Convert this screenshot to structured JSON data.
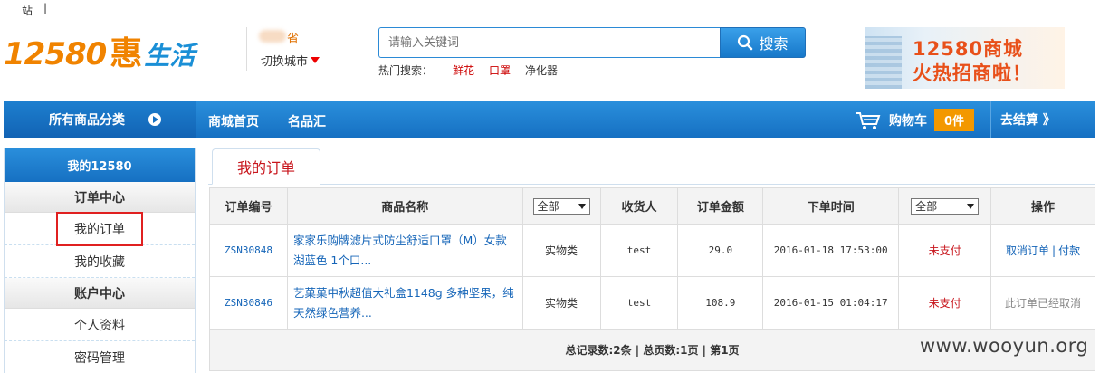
{
  "topbar": {
    "site_char": "站",
    "separator": "|"
  },
  "logo": {
    "number": "12580",
    "hui": "惠",
    "shenghuo": "生活"
  },
  "location": {
    "province_suffix": "省",
    "switch_city": "切换城市"
  },
  "search": {
    "placeholder": "请输入关键词",
    "button_label": "搜索"
  },
  "hot_search": {
    "label": "热门搜索：",
    "items": [
      "鲜花",
      "口罩",
      "净化器"
    ]
  },
  "banner": {
    "line1": "12580商城",
    "line2": "火热招商啦！"
  },
  "nav": {
    "all_categories": "所有商品分类",
    "links": [
      "商城首页",
      "名品汇"
    ],
    "cart_label": "购物车",
    "cart_count": "0件",
    "checkout": "去结算 》"
  },
  "sidebar": {
    "header": "我的12580",
    "sections": [
      {
        "title": "订单中心",
        "items": [
          "我的订单",
          "我的收藏"
        ]
      },
      {
        "title": "账户中心",
        "items": [
          "个人资料",
          "密码管理"
        ]
      }
    ]
  },
  "content": {
    "tab": "我的订单",
    "columns": [
      "订单编号",
      "商品名称",
      "全部",
      "收货人",
      "订单金额",
      "下单时间",
      "全部",
      "操作"
    ],
    "rows": [
      {
        "order_id": "ZSN30848",
        "product": "家家乐购牌滤片式防尘舒适口罩（M）女款湖蓝色 1个口...",
        "type": "实物类",
        "receiver": "test",
        "amount": "29.0",
        "time": "2016-01-18 17:53:00",
        "status": "未支付",
        "op_cancel": "取消订单",
        "op_sep": "|",
        "op_pay": "付款"
      },
      {
        "order_id": "ZSN30846",
        "product": "艺菓菓中秋超值大礼盒1148g 多种坚果，纯天然绿色营养...",
        "type": "实物类",
        "receiver": "test",
        "amount": "108.9",
        "time": "2016-01-15 01:04:17",
        "status": "未支付",
        "op_text": "此订单已经取消"
      }
    ],
    "footer": "总记录数:2条  | 总页数:1页 | 第1页"
  },
  "watermark": "www.wooyun.org"
}
